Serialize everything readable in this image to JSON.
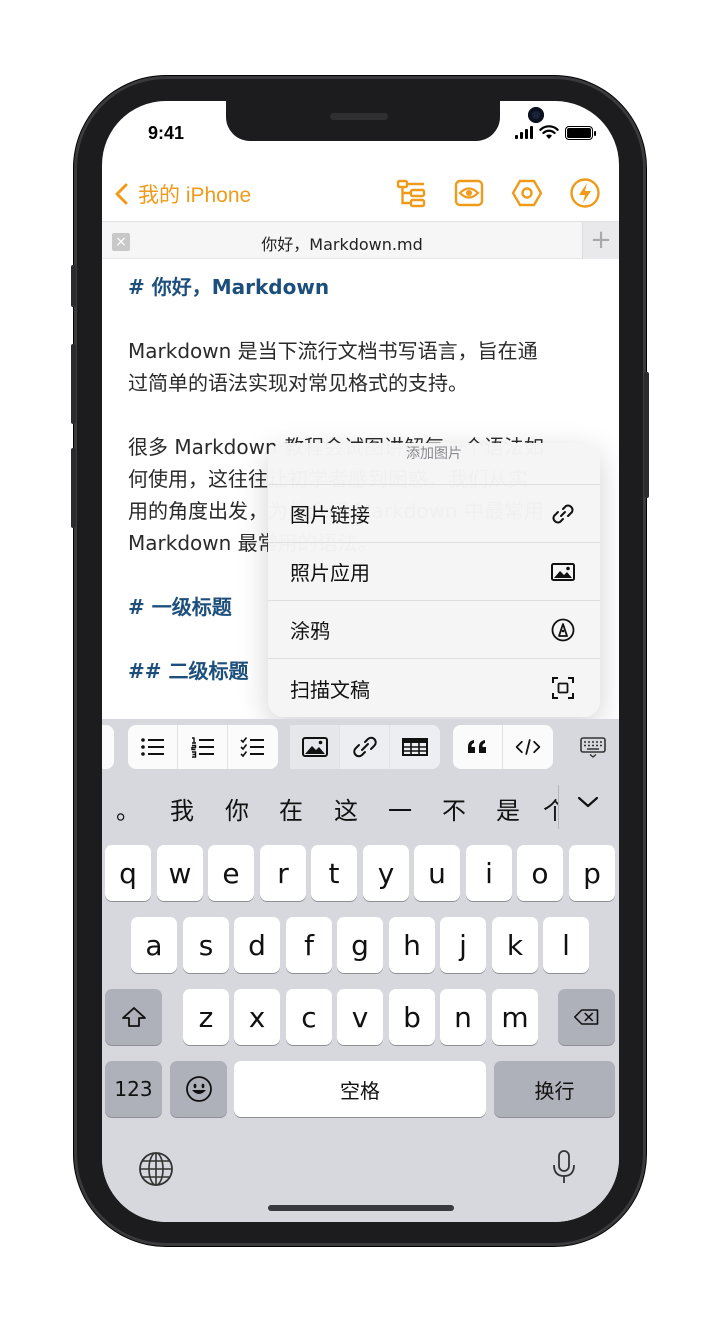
{
  "status": {
    "time": "9:41"
  },
  "nav": {
    "back_label": "我的 iPhone",
    "icons": [
      "outline-icon",
      "preview-icon",
      "settings-icon",
      "action-icon"
    ]
  },
  "tab": {
    "title": "你好，Markdown.md",
    "close": "×",
    "add": "+"
  },
  "editor": {
    "lines": [
      "# 你好，Markdown",
      "",
      "Markdown 是当下流行文档书写语言，旨在通",
      "过简单的语法实现对常见格式的支持。",
      "",
      "很多 Markdown 教程会试图讲解每一个语法如",
      "何使用，这往往让初学者感到困惑，我们从实",
      "用的角度出发，为你介绍 Markdown 中最常用",
      "Markdown 最常用的语法。",
      "",
      "# 一级标题",
      "",
      "## 二级标题"
    ]
  },
  "popup": {
    "title": "添加图片",
    "items": [
      {
        "label": "图片链接",
        "icon": "link-icon"
      },
      {
        "label": "照片应用",
        "icon": "photo-icon"
      },
      {
        "label": "涂鸦",
        "icon": "pen-tip-icon"
      },
      {
        "label": "扫描文稿",
        "icon": "scan-icon"
      }
    ]
  },
  "toolbar": {
    "buttons": [
      "bulleted-list-icon",
      "numbered-list-icon",
      "checklist-icon",
      "image-icon",
      "link-icon",
      "table-icon",
      "quote-icon",
      "code-icon",
      "keyboard-dismiss-icon"
    ]
  },
  "candidates": [
    "。",
    "我",
    "你",
    "在",
    "这",
    "一",
    "不",
    "是",
    "个"
  ],
  "keyboard": {
    "row1": [
      "q",
      "w",
      "e",
      "r",
      "t",
      "y",
      "u",
      "i",
      "o",
      "p"
    ],
    "row2": [
      "a",
      "s",
      "d",
      "f",
      "g",
      "h",
      "j",
      "k",
      "l"
    ],
    "row3": [
      "z",
      "x",
      "c",
      "v",
      "b",
      "n",
      "m"
    ],
    "numbers_label": "123",
    "space_label": "空格",
    "return_label": "换行"
  },
  "colors": {
    "accent": "#f09a1a",
    "heading": "#1d4f7c"
  }
}
